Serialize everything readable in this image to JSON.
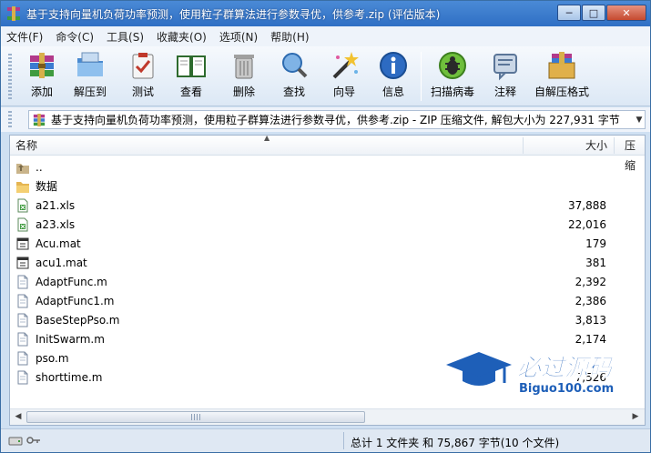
{
  "window": {
    "title": "基于支持向量机负荷功率预测，使用粒子群算法进行参数寻优，供参考.zip (评估版本)",
    "controls": {
      "minimize": "─",
      "maximize": "□",
      "close": "✕"
    }
  },
  "menu": [
    "文件(F)",
    "命令(C)",
    "工具(S)",
    "收藏夹(O)",
    "选项(N)",
    "帮助(H)"
  ],
  "toolbar": {
    "add": "添加",
    "extract": "解压到",
    "test": "测试",
    "view": "查看",
    "delete": "删除",
    "find": "查找",
    "wizard": "向导",
    "info": "信息",
    "scan": "扫描病毒",
    "comment": "注释",
    "sfx": "自解压格式"
  },
  "address": {
    "text": "基于支持向量机负荷功率预测，使用粒子群算法进行参数寻优，供参考.zip - ZIP 压缩文件, 解包大小为 227,931 字节"
  },
  "columns": {
    "name": "名称",
    "size": "大小",
    "compressed": "压缩"
  },
  "files": [
    {
      "name": "..",
      "size": "",
      "icon": "folder-up-icon"
    },
    {
      "name": "数据",
      "size": "",
      "icon": "folder-icon"
    },
    {
      "name": "a21.xls",
      "size": "37,888",
      "icon": "xls-file-icon"
    },
    {
      "name": "a23.xls",
      "size": "22,016",
      "icon": "xls-file-icon"
    },
    {
      "name": "Acu.mat",
      "size": "179",
      "icon": "mat-file-icon"
    },
    {
      "name": "acu1.mat",
      "size": "381",
      "icon": "mat-file-icon"
    },
    {
      "name": "AdaptFunc.m",
      "size": "2,392",
      "icon": "m-file-icon"
    },
    {
      "name": "AdaptFunc1.m",
      "size": "2,386",
      "icon": "m-file-icon"
    },
    {
      "name": "BaseStepPso.m",
      "size": "3,813",
      "icon": "m-file-icon"
    },
    {
      "name": "InitSwarm.m",
      "size": "2,174",
      "icon": "m-file-icon"
    },
    {
      "name": "pso.m",
      "size": "",
      "icon": "m-file-icon"
    },
    {
      "name": "shorttime.m",
      "size": "7,526",
      "icon": "m-file-icon"
    }
  ],
  "status": {
    "text": "总计 1 文件夹 和 75,867 字节(10 个文件)"
  },
  "watermark": {
    "brand": "必过源码",
    "url": "Biguo100.com"
  },
  "colors": {
    "title_bar": "#2f6fc4",
    "chrome": "#cfe0f2",
    "watermark": "#1e5fb8"
  }
}
